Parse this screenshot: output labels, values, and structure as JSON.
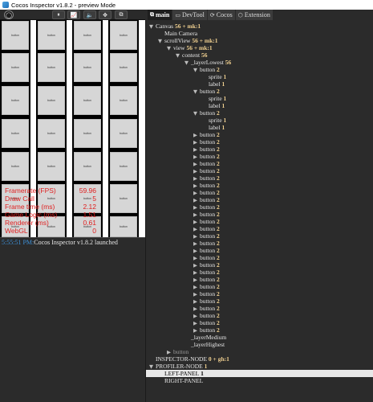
{
  "window": {
    "title": "Cocos Inspector v1.8.2 - preview Mode"
  },
  "toolbar": {
    "buttons": [
      "record",
      "pause",
      "chart",
      "volume",
      "move",
      "copy"
    ],
    "glyphs": [
      "◯",
      "⏸",
      "📈",
      "🔈",
      "✥",
      "⧉"
    ]
  },
  "tabs": [
    {
      "label": "main",
      "icon": "⧉",
      "active": true
    },
    {
      "label": "DevTool",
      "icon": "▭",
      "active": false
    },
    {
      "label": "Cocos",
      "icon": "⟳",
      "active": false
    },
    {
      "label": "Extension",
      "icon": "⬡",
      "active": false
    }
  ],
  "scene": {
    "button_text": "button",
    "stats": [
      {
        "label": "Framerate (FPS)",
        "value": "59.96"
      },
      {
        "label": "Draw Call",
        "value": "5"
      },
      {
        "label": "Frame time (ms)",
        "value": "2.12"
      },
      {
        "label": "Game Logic (ms)",
        "value": "1.51"
      },
      {
        "label": "Renderer (ms)",
        "value": "0.61"
      },
      {
        "label": "WebGL",
        "value": "0"
      }
    ]
  },
  "console": {
    "time": "5:55:51 PM:",
    "message": "Cocos Inspector v1.8.2 launched"
  },
  "tree": [
    {
      "depth": 0,
      "tri": "▼",
      "name": "Canvas",
      "count": "56 + mk:1"
    },
    {
      "depth": 1,
      "tri": "",
      "name": "Main Camera",
      "count": ""
    },
    {
      "depth": 1,
      "tri": "▼",
      "name": "scrollView",
      "count": "56 + mk:1"
    },
    {
      "depth": 2,
      "tri": "▼",
      "name": "view",
      "count": "56 + mk:1"
    },
    {
      "depth": 3,
      "tri": "▼",
      "name": "content",
      "count": "56"
    },
    {
      "depth": 4,
      "tri": "▼",
      "name": "_layerLowest",
      "count": "56"
    },
    {
      "depth": 5,
      "tri": "▼",
      "name": "button",
      "count": "2"
    },
    {
      "depth": 6,
      "tri": "",
      "name": "sprite",
      "count": "1"
    },
    {
      "depth": 6,
      "tri": "",
      "name": "label",
      "count": "1"
    },
    {
      "depth": 5,
      "tri": "▼",
      "name": "button",
      "count": "2"
    },
    {
      "depth": 6,
      "tri": "",
      "name": "sprite",
      "count": "1"
    },
    {
      "depth": 6,
      "tri": "",
      "name": "label",
      "count": "1"
    },
    {
      "depth": 5,
      "tri": "▼",
      "name": "button",
      "count": "2"
    },
    {
      "depth": 6,
      "tri": "",
      "name": "sprite",
      "count": "1"
    },
    {
      "depth": 6,
      "tri": "",
      "name": "label",
      "count": "1"
    },
    {
      "depth": 5,
      "tri": "▶",
      "name": "button",
      "count": "2"
    },
    {
      "depth": 5,
      "tri": "▶",
      "name": "button",
      "count": "2"
    },
    {
      "depth": 5,
      "tri": "▶",
      "name": "button",
      "count": "2"
    },
    {
      "depth": 5,
      "tri": "▶",
      "name": "button",
      "count": "2"
    },
    {
      "depth": 5,
      "tri": "▶",
      "name": "button",
      "count": "2"
    },
    {
      "depth": 5,
      "tri": "▶",
      "name": "button",
      "count": "2"
    },
    {
      "depth": 5,
      "tri": "▶",
      "name": "button",
      "count": "2"
    },
    {
      "depth": 5,
      "tri": "▶",
      "name": "button",
      "count": "2"
    },
    {
      "depth": 5,
      "tri": "▶",
      "name": "button",
      "count": "2"
    },
    {
      "depth": 5,
      "tri": "▶",
      "name": "button",
      "count": "2"
    },
    {
      "depth": 5,
      "tri": "▶",
      "name": "button",
      "count": "2"
    },
    {
      "depth": 5,
      "tri": "▶",
      "name": "button",
      "count": "2"
    },
    {
      "depth": 5,
      "tri": "▶",
      "name": "button",
      "count": "2"
    },
    {
      "depth": 5,
      "tri": "▶",
      "name": "button",
      "count": "2"
    },
    {
      "depth": 5,
      "tri": "▶",
      "name": "button",
      "count": "2"
    },
    {
      "depth": 5,
      "tri": "▶",
      "name": "button",
      "count": "2"
    },
    {
      "depth": 5,
      "tri": "▶",
      "name": "button",
      "count": "2"
    },
    {
      "depth": 5,
      "tri": "▶",
      "name": "button",
      "count": "2"
    },
    {
      "depth": 5,
      "tri": "▶",
      "name": "button",
      "count": "2"
    },
    {
      "depth": 5,
      "tri": "▶",
      "name": "button",
      "count": "2"
    },
    {
      "depth": 5,
      "tri": "▶",
      "name": "button",
      "count": "2"
    },
    {
      "depth": 5,
      "tri": "▶",
      "name": "button",
      "count": "2"
    },
    {
      "depth": 5,
      "tri": "▶",
      "name": "button",
      "count": "2"
    },
    {
      "depth": 5,
      "tri": "▶",
      "name": "button",
      "count": "2"
    },
    {
      "depth": 5,
      "tri": "▶",
      "name": "button",
      "count": "2"
    },
    {
      "depth": 5,
      "tri": "▶",
      "name": "button",
      "count": "2"
    },
    {
      "depth": 5,
      "tri": "▶",
      "name": "button",
      "count": "2"
    },
    {
      "depth": 5,
      "tri": "▶",
      "name": "button",
      "count": "2"
    },
    {
      "depth": 4,
      "tri": "",
      "name": "_layerMedium",
      "count": ""
    },
    {
      "depth": 4,
      "tri": "",
      "name": "_layerHighest",
      "count": ""
    },
    {
      "depth": 2,
      "tri": "▶",
      "name": "button",
      "count": "",
      "dim": true
    },
    {
      "depth": 0,
      "tri": "",
      "name": "INSPECTOR-NODE",
      "count": "0 + gh:1"
    },
    {
      "depth": 0,
      "tri": "▼",
      "name": "PROFILER-NODE",
      "count": "1"
    },
    {
      "depth": 1,
      "tri": "",
      "name": "LEFT-PANEL",
      "count": "1",
      "selected": true
    },
    {
      "depth": 1,
      "tri": "",
      "name": "RIGHT-PANEL",
      "count": ""
    }
  ]
}
